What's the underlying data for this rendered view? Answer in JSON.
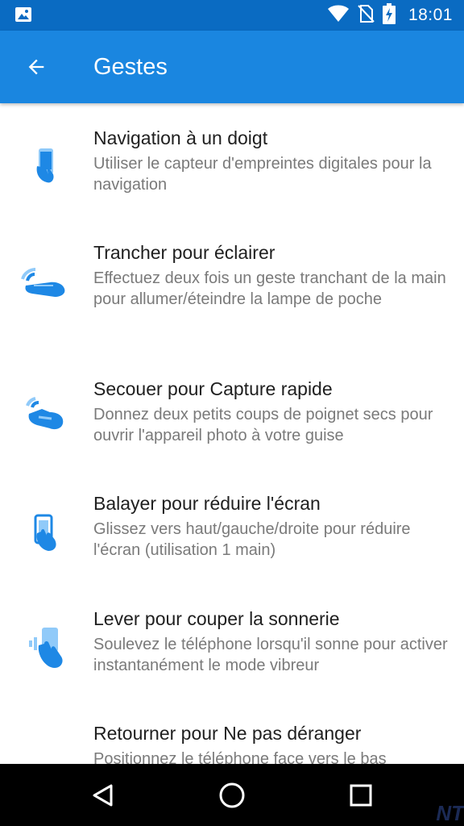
{
  "status_bar": {
    "time": "18:01",
    "icons": [
      "image-icon",
      "wifi-icon",
      "no-sim-icon",
      "battery-charging-icon"
    ]
  },
  "app_bar": {
    "title": "Gestes",
    "back_icon": "arrow-left-icon"
  },
  "items": [
    {
      "title": "Navigation à un doigt",
      "description": "Utiliser le capteur d'empreintes digitales pour la navigation",
      "icon": "fingerprint-phone-icon"
    },
    {
      "title": "Trancher pour éclairer",
      "description": "Effectuez deux fois un geste tranchant de la main pour allumer/éteindre la lampe de poche",
      "icon": "hand-chop-icon"
    },
    {
      "title": "Secouer pour Capture rapide",
      "description": "Donnez deux petits coups de poignet secs pour ouvrir l'appareil photo à votre guise",
      "icon": "hand-shake-icon"
    },
    {
      "title": "Balayer pour réduire l'écran",
      "description": "Glissez vers haut/gauche/droite pour réduire l'écran (utilisation 1 main)",
      "icon": "swipe-phone-icon"
    },
    {
      "title": "Lever pour couper la sonnerie",
      "description": "Soulevez le téléphone lorsqu'il sonne pour activer instantanément le mode vibreur",
      "icon": "lift-phone-icon"
    },
    {
      "title": "Retourner pour Ne pas déranger",
      "description": "Positionnez le téléphone face vers le bas",
      "icon": "flip-phone-icon"
    }
  ],
  "nav_bar": {
    "back": "nav-back-icon",
    "home": "nav-home-icon",
    "recents": "nav-recents-icon"
  },
  "watermark": "NT",
  "colors": {
    "status_bar": "#0a6bc2",
    "app_bar": "#1a86e0",
    "icon_primary": "#1e88e5",
    "icon_light": "#90caf9"
  }
}
